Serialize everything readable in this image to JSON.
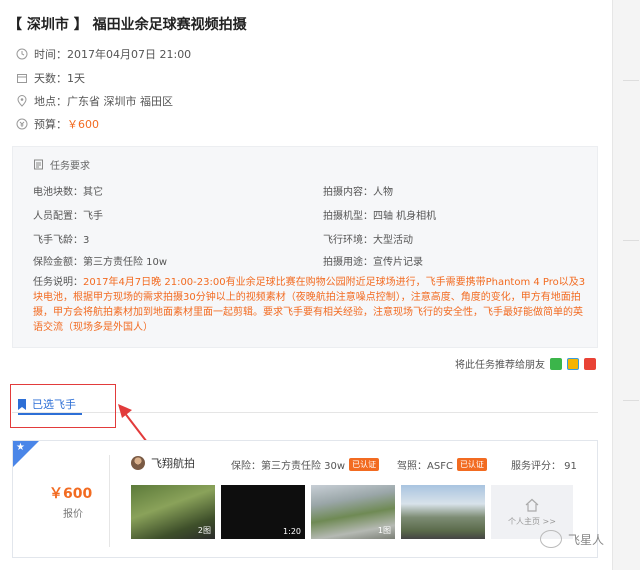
{
  "task": {
    "title_prefix": "【 深圳市 】",
    "title": "福田业余足球赛视频拍摄",
    "time_label": "时间：",
    "time_value": "2017年04月07日 21:00",
    "days_label": "天数：",
    "days_value": "1天",
    "location_label": "地点：",
    "location_value": "广东省 深圳市 福田区",
    "budget_label": "预算：",
    "budget_value": "￥600"
  },
  "requirements": {
    "heading": "任务要求",
    "battery": "电池块数：其它",
    "content": "拍摄内容：人物",
    "staff": "人员配置：飞手",
    "model": "拍摄机型：四轴 机身相机",
    "experience": "飞手飞龄：3",
    "environment": "飞行环境：大型活动",
    "insurance": "保险金额：第三方责任险 10w",
    "usage": "拍摄用途：宣传片记录",
    "desc_label": "任务说明：",
    "desc_highlight": "2017年4月7日晚 21:00-23:00有业余足球比赛在购物公园附近足球场进行，飞手需要携带Phantom 4 Pro以及3块电池，根据甲方现场的需求拍摄30分钟以上的视频素材（夜晚航拍注意噪点控制），注意高度、角度的变化，甲方有地面拍摄，甲方会将航拍素材加到地面素材里面一起剪辑。要求飞手要有相关经验，注意现场飞行的安全性，飞手最好能做简单的英语交流（现场多是外国人）"
  },
  "share": {
    "text": "将此任务推荐给朋友"
  },
  "tab": {
    "label": "已选飞手"
  },
  "selected": {
    "price": "￥600",
    "price_label": "报价",
    "pilot_name": "飞翔航拍",
    "insurance": "保险：第三方责任险 30w",
    "insurance_badge": "已认证",
    "license": "驾照：ASFC",
    "license_badge": "已认证",
    "rating": "服务评分：  91",
    "thumbs": [
      {
        "caption": "2图"
      },
      {
        "caption": "1:20"
      },
      {
        "caption": "1图"
      },
      {
        "caption": ""
      }
    ],
    "home_label": "个人主页 >>"
  },
  "watermark": {
    "text": "飞星人"
  },
  "colors": {
    "accent": "#2d6fd6",
    "price": "#f26b21",
    "highlight_box": "#e23b3b"
  }
}
